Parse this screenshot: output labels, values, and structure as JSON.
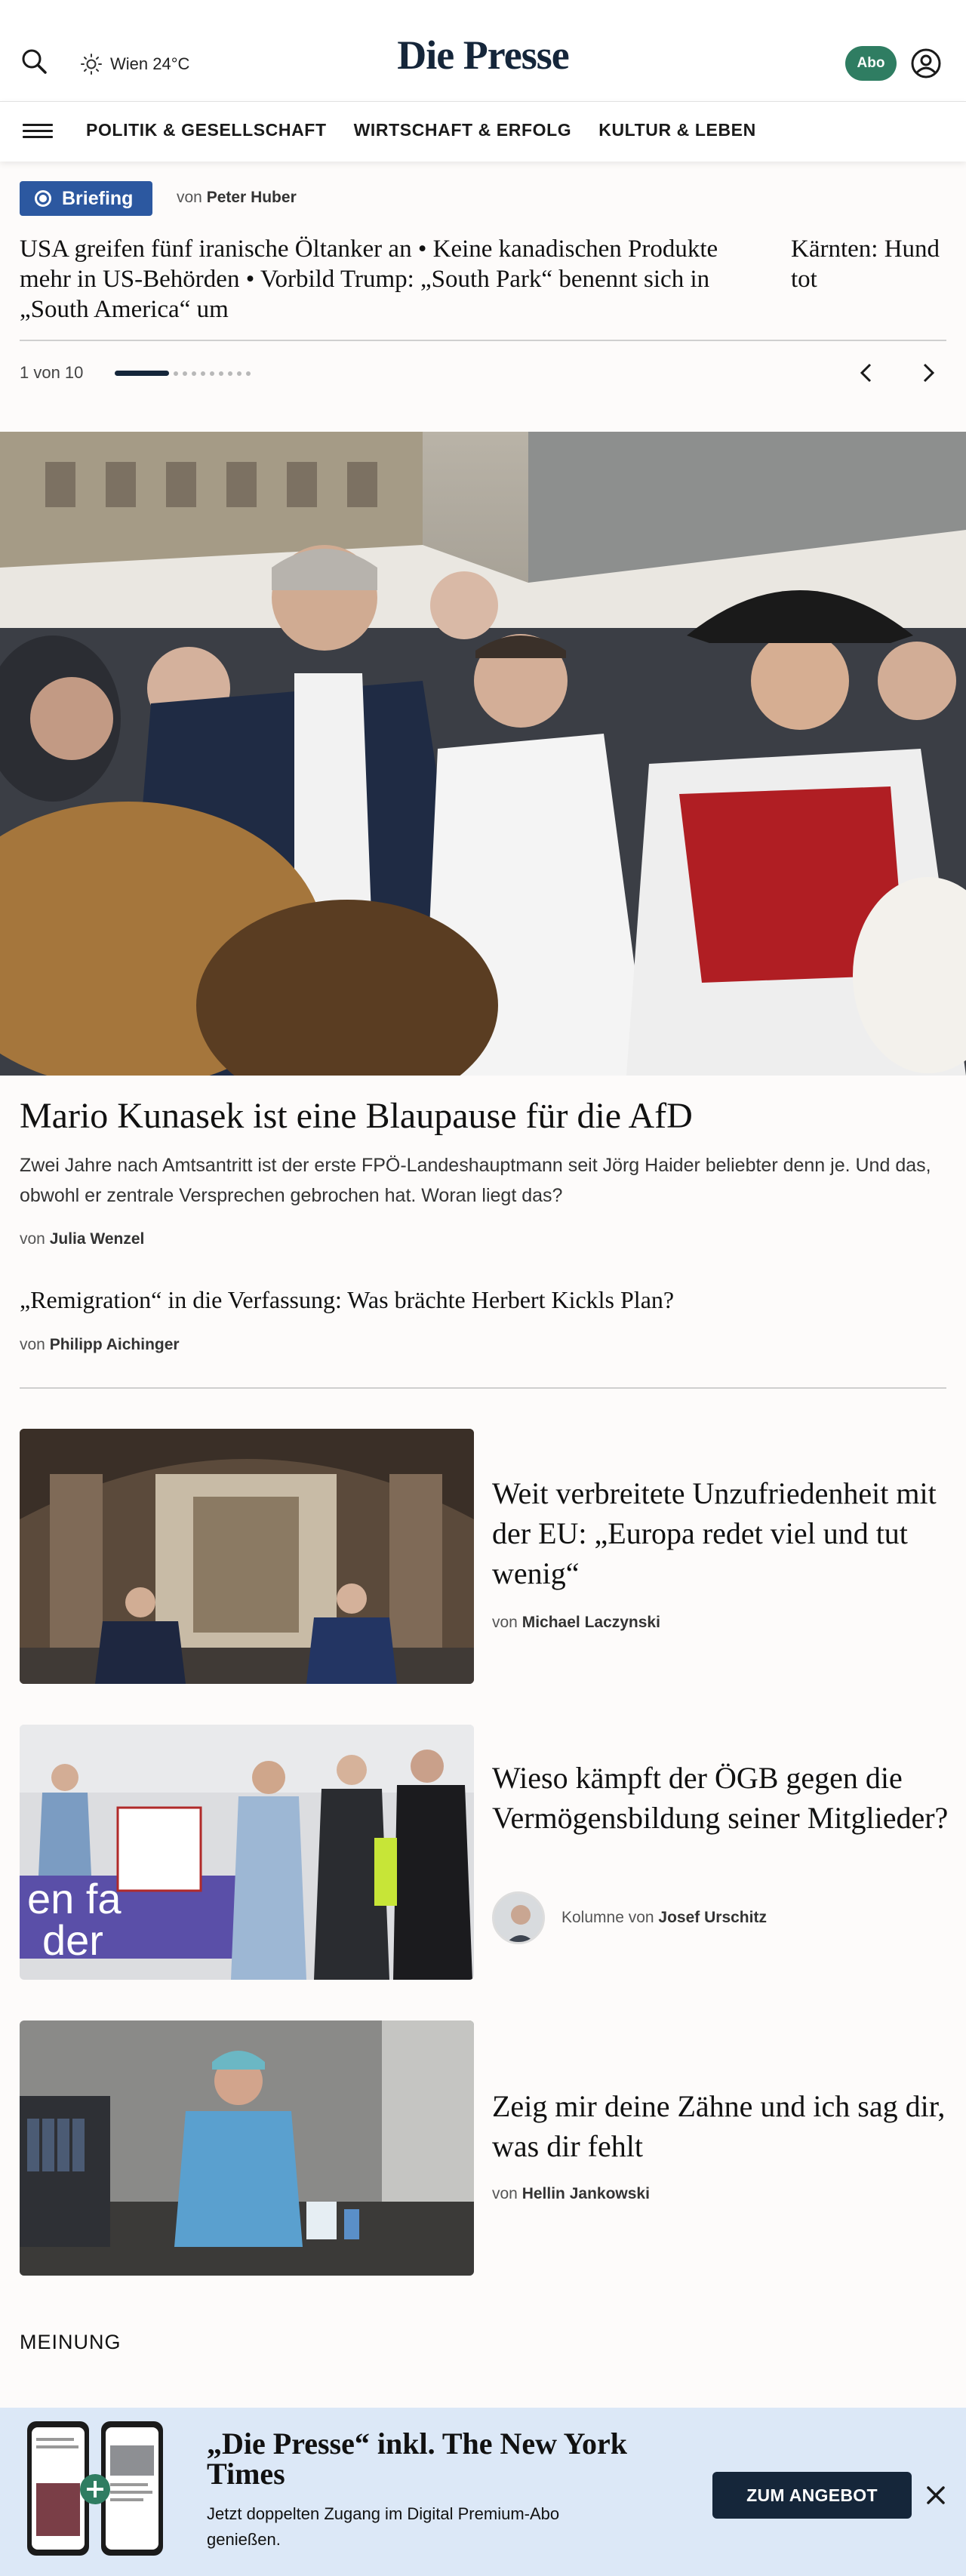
{
  "header": {
    "weather": "Wien 24°C",
    "logo": "Die Presse",
    "abo_label": "Abo"
  },
  "nav": {
    "items": [
      "POLITIK & GESELLSCHAFT",
      "WIRTSCHAFT & ERFOLG",
      "KULTUR & LEBEN"
    ]
  },
  "briefing": {
    "tag": "Briefing",
    "by_prefix": "von",
    "author": "Peter Huber",
    "main_text": "USA greifen fünf iranische Öltanker an • Keine kanadischen Produkte mehr in US-Behörden • Vorbild Trump: „South Park“ benennt sich in „South America“ um",
    "side_text": "Kärnten: Hund tot",
    "pager": "1 von 10"
  },
  "hero": {
    "title": "Mario Kunasek ist eine Blaupause für die AfD",
    "teaser": "Zwei Jahre nach Amtsantritt ist der erste FPÖ-Landeshauptmann seit Jörg Haider beliebter denn je. Und das, obwohl er zentrale Versprechen gebrochen hat. Woran liegt das?",
    "by_prefix": "von",
    "author": "Julia Wenzel",
    "sub_title": "„Remigration“ in die Verfassung: Was brächte Herbert Kickls Plan?",
    "sub_author": "Philipp Aichinger"
  },
  "articles": [
    {
      "title": "Weit verbreitete Unzufriedenheit mit der EU: „Europa redet viel und tut wenig“",
      "by_prefix": "von",
      "author": "Michael Laczynski"
    },
    {
      "title": "Wieso kämpft der ÖGB gegen die Vermögensbildung seiner Mitglieder?",
      "by_prefix": "Kolumne von",
      "author": "Josef Urschitz"
    },
    {
      "title": "Zeig mir deine Zähne und ich sag dir, was dir fehlt",
      "by_prefix": "von",
      "author": "Hellin Jankowski"
    }
  ],
  "meinung": {
    "heading": "MEINUNG"
  },
  "promo": {
    "title": "„Die Presse“ inkl. The New York Times",
    "subtitle": "Jetzt doppelten Zugang im Digital Premium-Abo genießen.",
    "button": "ZUM ANGEBOT"
  },
  "colors": {
    "brand_navy": "#15263a",
    "abo_green": "#2f7d62",
    "briefing_blue": "#2c58a0",
    "promo_bg": "#dce8f7"
  }
}
